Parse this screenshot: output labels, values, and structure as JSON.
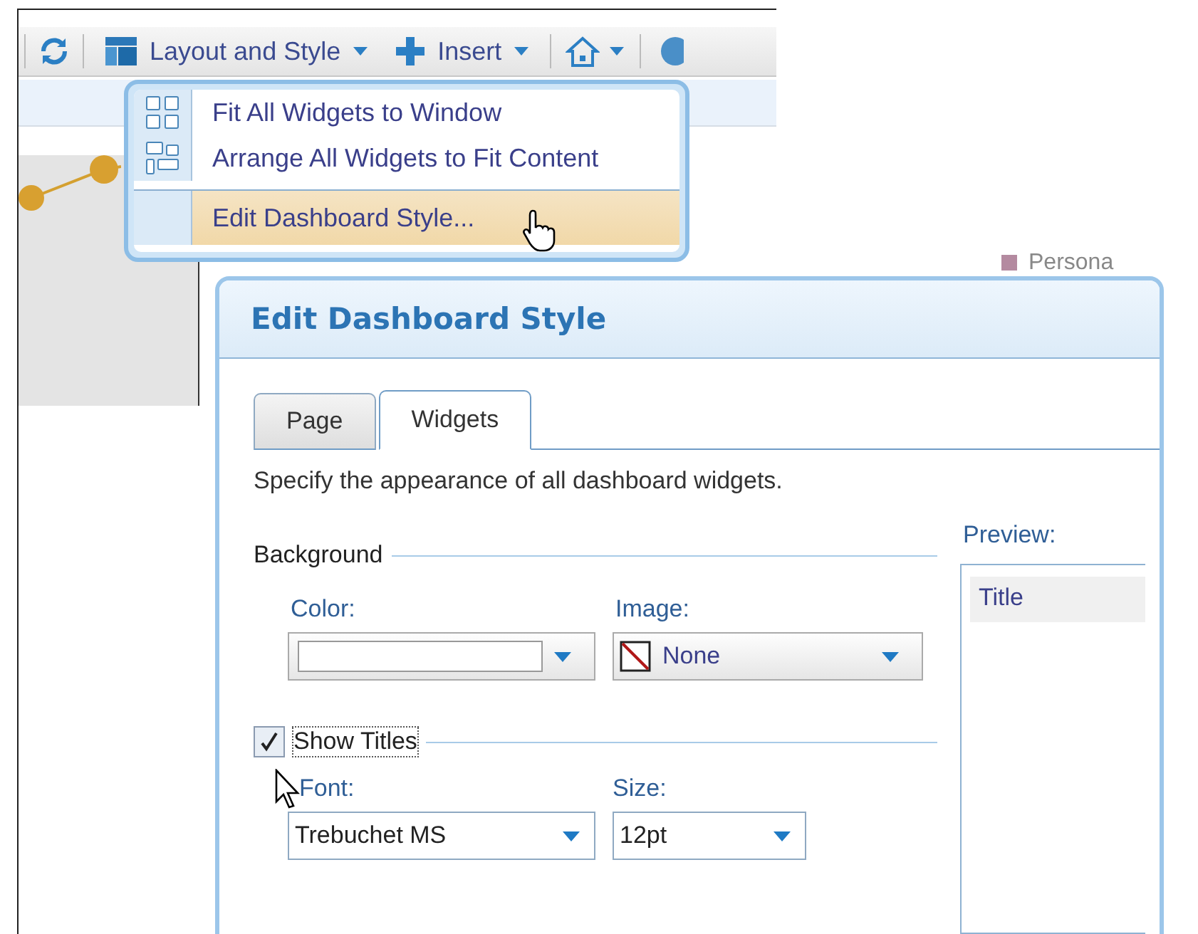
{
  "toolbar": {
    "layout_menu": "Layout and Style",
    "insert_menu": "Insert"
  },
  "background_legend": "Persona",
  "menu": {
    "items": [
      {
        "label": "Fit All Widgets to Window",
        "selected": false
      },
      {
        "label": "Arrange All Widgets to Fit Content",
        "selected": false
      },
      {
        "label": "Edit Dashboard Style...",
        "selected": true
      }
    ]
  },
  "dialog": {
    "title": "Edit Dashboard Style",
    "tabs": [
      {
        "label": "Page",
        "selected": false
      },
      {
        "label": "Widgets",
        "selected": true
      }
    ],
    "description": "Specify the appearance of all dashboard widgets.",
    "background": {
      "heading": "Background",
      "color_label": "Color:",
      "image_label": "Image:",
      "image_value": "None"
    },
    "show_titles": {
      "label": "Show Titles",
      "checked": true
    },
    "font_label": "Font:",
    "font_value": "Trebuchet MS",
    "size_label": "Size:",
    "size_value": "12pt",
    "preview": {
      "label": "Preview:",
      "title": "Title"
    }
  }
}
